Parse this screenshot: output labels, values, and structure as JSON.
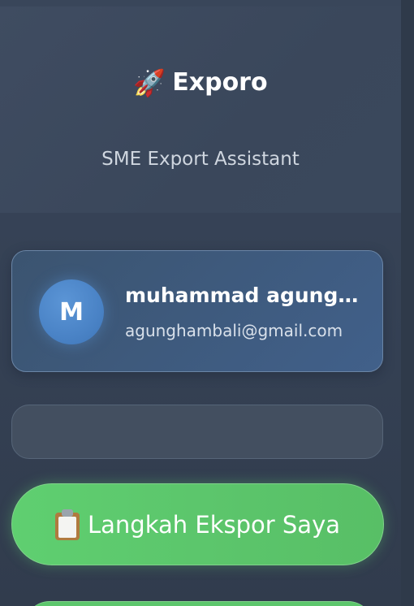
{
  "app": {
    "icon": "rocket-icon",
    "title": "Exporo",
    "subtitle": "SME Export Assistant"
  },
  "user": {
    "avatar_initial": "M",
    "name": "muhammad agung h…",
    "email": "agunghambali@gmail.com"
  },
  "search": {
    "value": ""
  },
  "menu": {
    "primary_button": {
      "icon": "clipboard-icon",
      "label": "Langkah Ekspor Saya"
    }
  },
  "colors": {
    "sidebar_bg": "#344053",
    "user_card": "#3e5a7d",
    "avatar": "#4a83c6",
    "primary_green": "#5cc66c"
  }
}
